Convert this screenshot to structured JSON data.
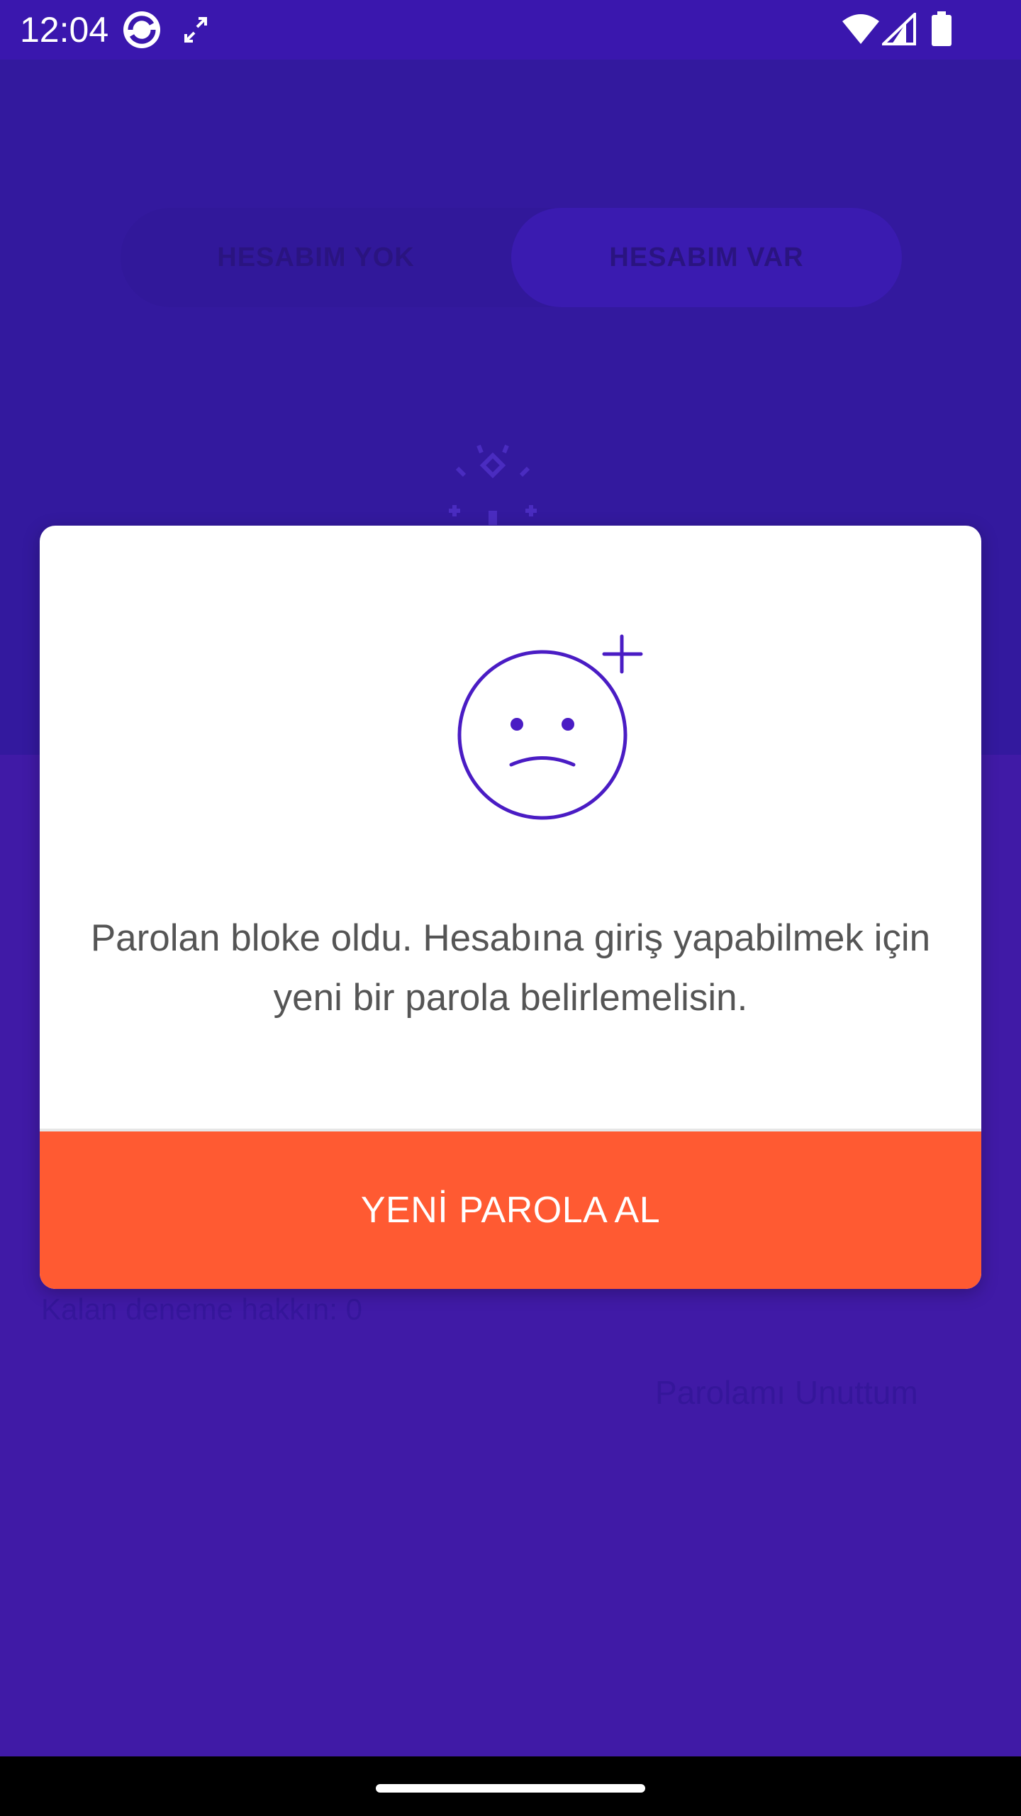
{
  "status_bar": {
    "time": "12:04",
    "icons": [
      "app-sync-icon",
      "screen-rotate-icon",
      "wifi-icon",
      "signal-icon",
      "battery-icon"
    ]
  },
  "background": {
    "tabs": [
      "HESABIM YOK",
      "HESABIM VAR"
    ],
    "remaining_attempts": "Kalan deneme hakkın: 0",
    "forgot_password": "Parolamı Unuttum"
  },
  "dialog": {
    "icon": "sad-face-icon",
    "message": "Parolan bloke oldu. Hesabına giriş yapabilmek için yeni bir parola belirlemelisin.",
    "button_label": "YENİ PAROLA AL"
  },
  "colors": {
    "accent": "#3d1ab0",
    "button": "#ff5a32",
    "background": "#401aa6"
  }
}
